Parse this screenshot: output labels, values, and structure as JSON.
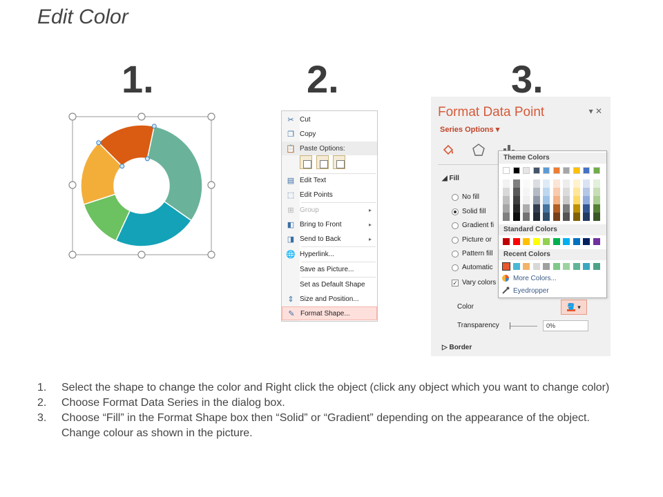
{
  "title": "Edit Color",
  "steps": [
    "1.",
    "2.",
    "3."
  ],
  "donut": {
    "colors": [
      "#6ab39a",
      "#14a2b8",
      "#6cc160",
      "#f3ae3a",
      "#d95c12"
    ]
  },
  "context_menu": {
    "items": [
      {
        "label": "Cut",
        "icon": "scissors-icon"
      },
      {
        "label": "Copy",
        "icon": "copy-icon"
      },
      {
        "label": "Paste Options:",
        "icon": "paste-icon"
      },
      {
        "label": "Edit Text",
        "icon": "edit-text-icon"
      },
      {
        "label": "Edit Points",
        "icon": "edit-points-icon"
      },
      {
        "label": "Group",
        "icon": "group-icon"
      },
      {
        "label": "Bring to Front",
        "icon": "bring-front-icon"
      },
      {
        "label": "Send to Back",
        "icon": "send-back-icon"
      },
      {
        "label": "Hyperlink...",
        "icon": "hyperlink-icon"
      },
      {
        "label": "Save as Picture...",
        "icon": ""
      },
      {
        "label": "Set as Default Shape",
        "icon": ""
      },
      {
        "label": "Size and Position...",
        "icon": "size-position-icon"
      },
      {
        "label": "Format Shape...",
        "icon": "format-shape-icon"
      }
    ]
  },
  "format_pane": {
    "title": "Format Data Point",
    "series_options": "Series Options",
    "fill_header": "Fill",
    "fill_options": [
      {
        "label": "No fill",
        "selected": false
      },
      {
        "label": "Solid fill",
        "selected": true
      },
      {
        "label": "Gradient fi",
        "selected": false
      },
      {
        "label": "Picture or",
        "selected": false
      },
      {
        "label": "Pattern fill",
        "selected": false
      },
      {
        "label": "Automatic",
        "selected": false
      }
    ],
    "vary_colors": "Vary colors",
    "color_label": "Color",
    "transparency_label": "Transparency",
    "transparency_value": "0%",
    "border_header": "Border",
    "accent": "#d55a3a"
  },
  "color_picker": {
    "theme_header": "Theme Colors",
    "standard_header": "Standard Colors",
    "recent_header": "Recent Colors",
    "more_colors": "More Colors...",
    "eyedropper": "Eyedropper",
    "theme_colors": [
      "#ffffff",
      "#000000",
      "#e7e6e6",
      "#44546a",
      "#5b9bd5",
      "#ed7d31",
      "#a5a5a5",
      "#ffc000",
      "#4472c4",
      "#70ad47"
    ],
    "standard_colors": [
      "#c00000",
      "#ff0000",
      "#ffc000",
      "#ffff00",
      "#92d050",
      "#00b050",
      "#00b0f0",
      "#0070c0",
      "#002060",
      "#7030a0"
    ],
    "recent_colors": [
      "#e8572d",
      "#4ab8d6",
      "#f2b36b",
      "#d8d8d8",
      "#a0a0a0",
      "#7fc98a",
      "#9bd3a0",
      "#5fb597",
      "#3aa9c0",
      "#4ca38a"
    ]
  },
  "instructions": [
    {
      "num": "1.",
      "text": "Select the shape to change the color and Right click the object (click any object which you want to change color)"
    },
    {
      "num": "2.",
      "text": "Choose Format Data Series in the dialog box."
    },
    {
      "num": "3.",
      "text": "Choose “Fill” in the Format Shape box then “Solid” or “Gradient” depending on the appearance of the object. Change colour as shown in the picture."
    }
  ]
}
